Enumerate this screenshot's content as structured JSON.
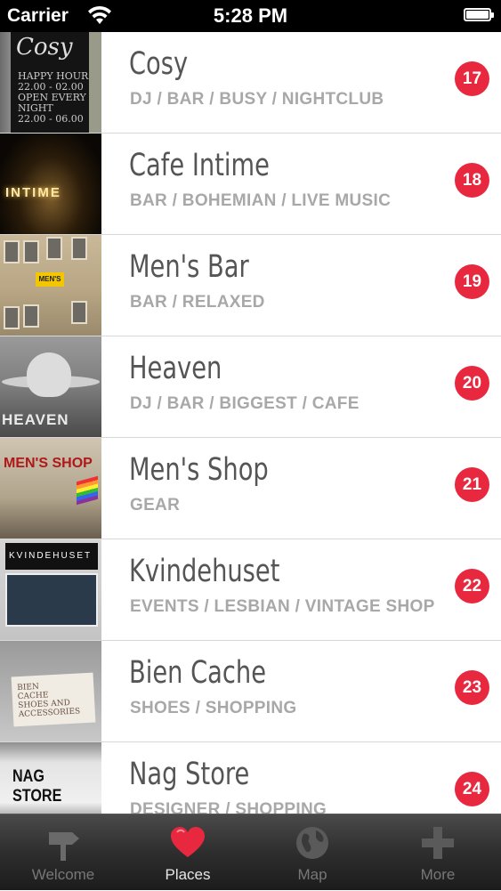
{
  "status_bar": {
    "carrier": "Carrier",
    "time": "5:28 PM"
  },
  "places": [
    {
      "name": "Cosy",
      "tags": "DJ / BAR / BUSY / NIGHTCLUB",
      "number": "17",
      "thumb_text": [
        "Cosy",
        "HAPPY HOUR",
        "22.00 - 02.00",
        "OPEN EVERY NIGHT",
        "22.00 - 06.00"
      ]
    },
    {
      "name": "Cafe Intime",
      "tags": "BAR / BOHEMIAN / LIVE MUSIC",
      "number": "18",
      "thumb_text": [
        "INTIME"
      ]
    },
    {
      "name": "Men's Bar",
      "tags": "BAR / RELAXED",
      "number": "19",
      "thumb_text": [
        "MEN'S"
      ]
    },
    {
      "name": "Heaven",
      "tags": "DJ / BAR / BIGGEST / CAFE",
      "number": "20",
      "thumb_text": [
        "HEAVEN"
      ]
    },
    {
      "name": "Men's Shop",
      "tags": "GEAR",
      "number": "21",
      "thumb_text": [
        "MEN'S SHOP"
      ]
    },
    {
      "name": "Kvindehuset",
      "tags": "EVENTS / LESBIAN / VINTAGE SHOP",
      "number": "22",
      "thumb_text": [
        "KVINDEHUSET"
      ]
    },
    {
      "name": "Bien Cache",
      "tags": "SHOES / SHOPPING",
      "number": "23",
      "thumb_text": [
        "BIEN",
        "CACHE",
        "SHOES AND",
        "ACCESSORIES"
      ]
    },
    {
      "name": "Nag Store",
      "tags": "DESIGNER / SHOPPING",
      "number": "24",
      "thumb_text": [
        "NAG STORE"
      ]
    }
  ],
  "tabbar": {
    "active": "places",
    "tabs": [
      {
        "id": "welcome",
        "label": "Welcome",
        "icon": "signpost-icon"
      },
      {
        "id": "places",
        "label": "Places",
        "icon": "heart-icon"
      },
      {
        "id": "map",
        "label": "Map",
        "icon": "globe-icon"
      },
      {
        "id": "more",
        "label": "More",
        "icon": "plus-icon"
      }
    ]
  },
  "colors": {
    "badge": "#e8283f",
    "title": "#555555",
    "tags": "#a8a8a8",
    "tab_active": "#e6e6e6",
    "tab_inactive": "#777777",
    "heart": "#e8283f"
  }
}
